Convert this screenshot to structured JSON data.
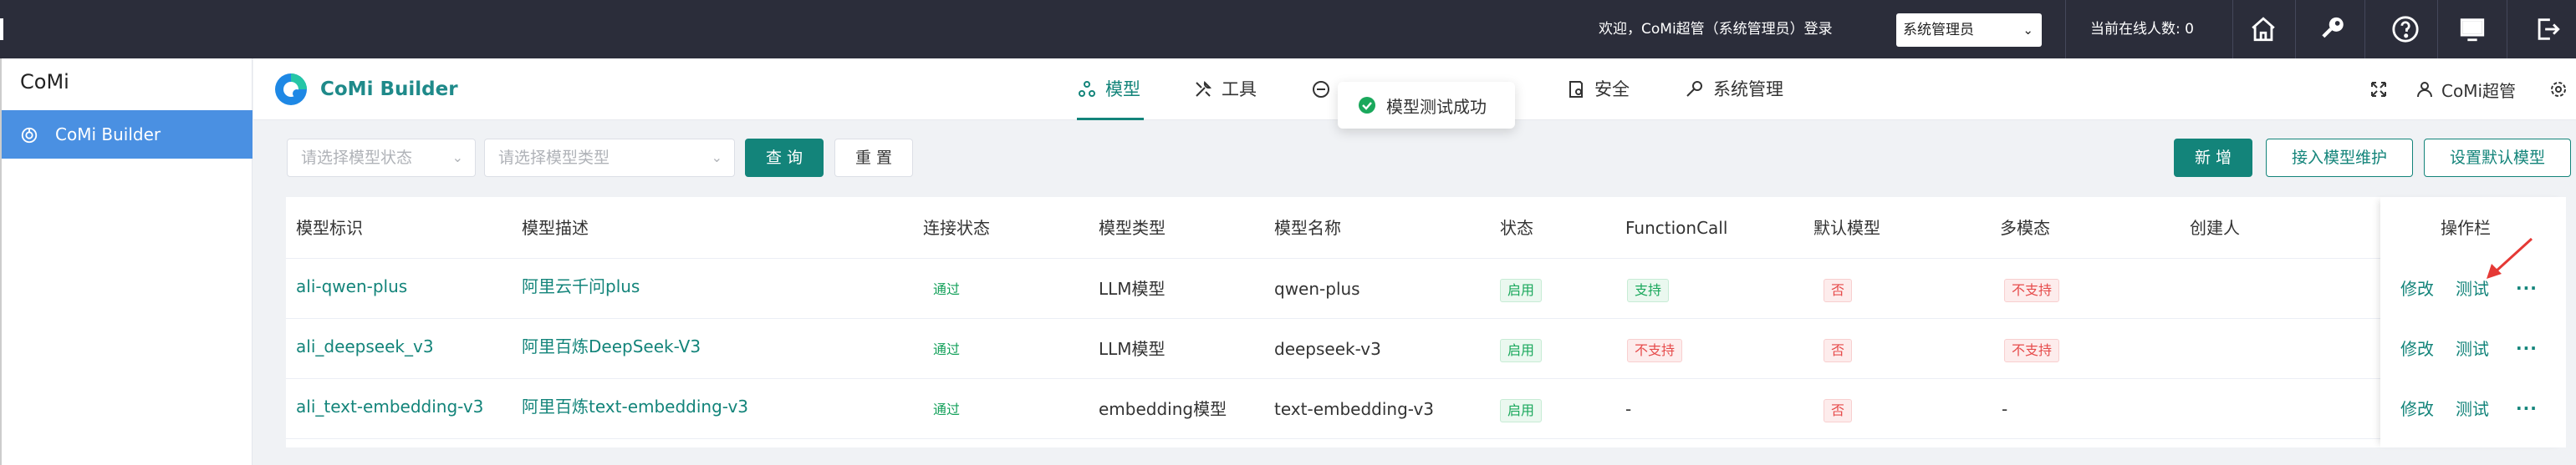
{
  "topbar": {
    "welcome": "欢迎，CoMi超管（系统管理员）登录",
    "role_selected": "系统管理员",
    "online_count": "当前在线人数: 0",
    "icons": [
      "home-icon",
      "key-icon",
      "help-icon",
      "monitor-icon",
      "logout-icon"
    ]
  },
  "sidebar": {
    "app_title": "CoMi",
    "items": [
      {
        "label": "CoMi Builder",
        "icon": "builder-icon"
      }
    ]
  },
  "header": {
    "brand": "CoMi Builder",
    "tabs": [
      {
        "label": "模型",
        "icon": "model-icon",
        "active": true
      },
      {
        "label": "工具",
        "icon": "tools-icon",
        "active": false
      },
      {
        "label": "安全",
        "icon": "shield-icon",
        "active": false
      },
      {
        "label": "系统管理",
        "icon": "wrench-icon",
        "active": false
      }
    ],
    "user_name": "CoMi超管"
  },
  "toast": {
    "message": "模型测试成功"
  },
  "filters": {
    "status_placeholder": "请选择模型状态",
    "type_placeholder": "请选择模型类型",
    "query_label": "查 询",
    "reset_label": "重 置",
    "add_label": "新 增",
    "access_label": "接入模型维护",
    "default_label": "设置默认模型"
  },
  "table": {
    "headers": [
      "模型标识",
      "模型描述",
      "连接状态",
      "模型类型",
      "模型名称",
      "状态",
      "FunctionCall",
      "默认模型",
      "多模态",
      "创建人",
      "操作栏"
    ],
    "rows": [
      {
        "id": "ali-qwen-plus",
        "desc": "阿里云千问plus",
        "conn": "通过",
        "type": "LLM模型",
        "name": "qwen-plus",
        "status": "启用",
        "fc": "支持",
        "fc_ok": true,
        "default": "否",
        "multimodal": "不支持",
        "mm_tag": true,
        "creator": ""
      },
      {
        "id": "ali_deepseek_v3",
        "desc": "阿里百炼DeepSeek-V3",
        "conn": "通过",
        "type": "LLM模型",
        "name": "deepseek-v3",
        "status": "启用",
        "fc": "不支持",
        "fc_ok": false,
        "default": "否",
        "multimodal": "不支持",
        "mm_tag": true,
        "creator": ""
      },
      {
        "id": "ali_text-embedding-v3",
        "desc": "阿里百炼text-embedding-v3",
        "conn": "通过",
        "type": "embedding模型",
        "name": "text-embedding-v3",
        "status": "启用",
        "fc": "-",
        "fc_ok": null,
        "default": "否",
        "multimodal": "-",
        "mm_tag": false,
        "creator": ""
      }
    ],
    "ops": {
      "edit": "修改",
      "test": "测试",
      "more": "···"
    }
  },
  "colors": {
    "accent": "#13847a",
    "topbar": "#2b2d3a",
    "sidebar_active": "#4a90e2"
  }
}
